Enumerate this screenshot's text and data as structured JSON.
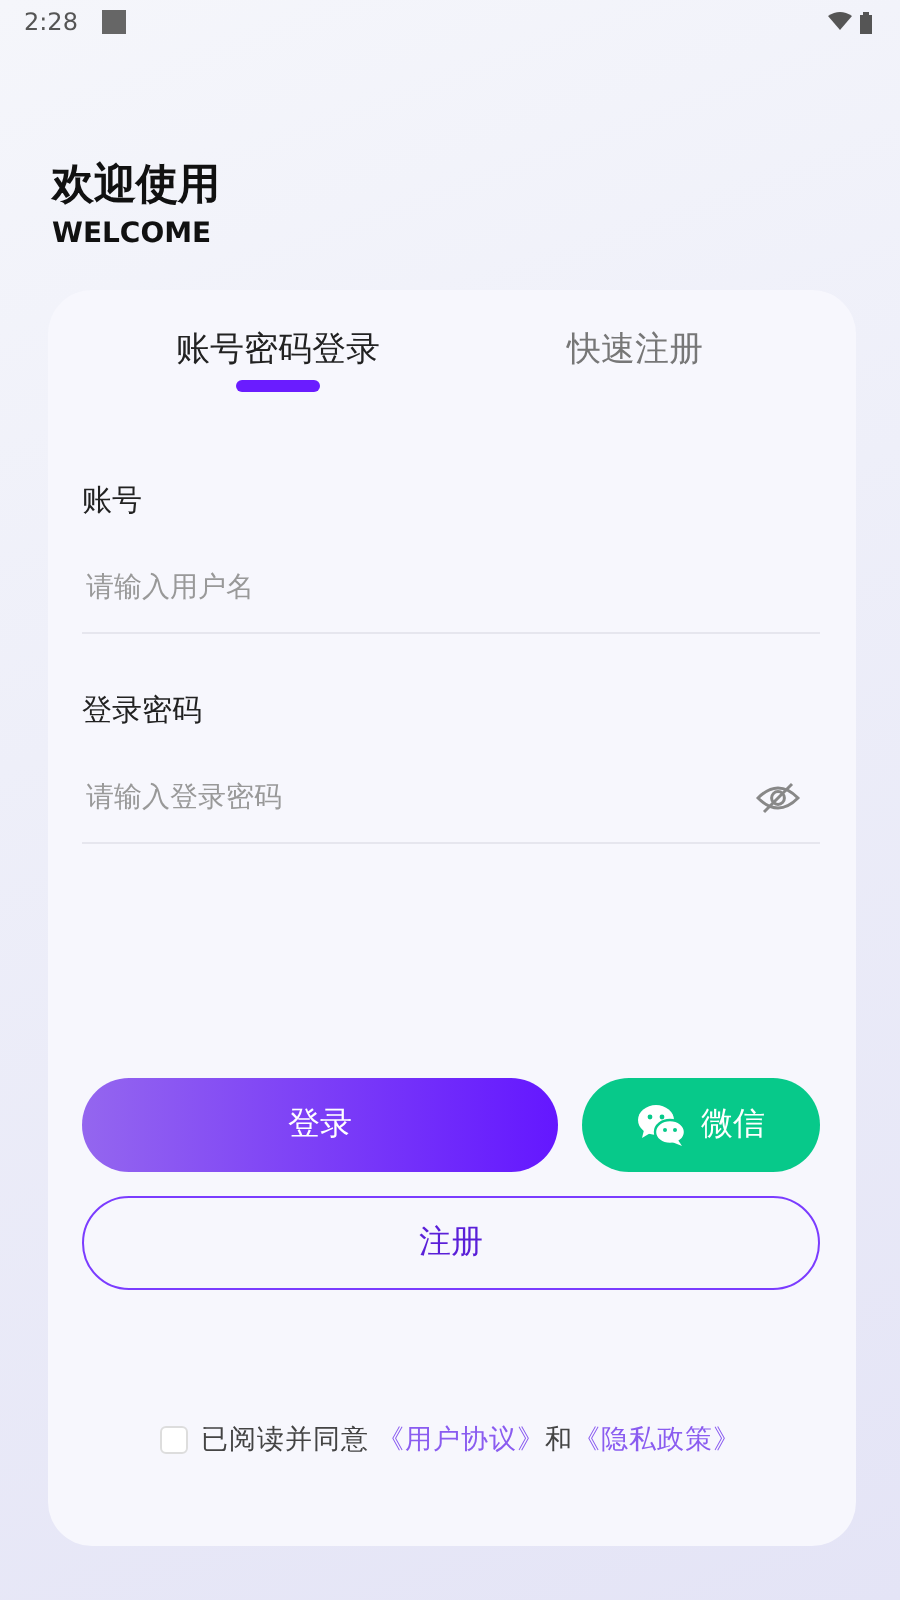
{
  "status_bar": {
    "time": "2:28"
  },
  "header": {
    "title": "欢迎使用",
    "subtitle": "WELCOME"
  },
  "tabs": [
    {
      "label": "账号密码登录",
      "selected": true
    },
    {
      "label": "快速注册",
      "selected": false
    }
  ],
  "fields": [
    {
      "label": "账号",
      "placeholder": "请输入用户名",
      "kind": "text"
    },
    {
      "label": "登录密码",
      "placeholder": "请输入登录密码",
      "kind": "password"
    }
  ],
  "buttons": [
    {
      "label": "登录",
      "kind": "primary"
    },
    {
      "label": "微信",
      "kind": "wechat"
    },
    {
      "label": "注册",
      "kind": "outline"
    }
  ],
  "agreement": {
    "checked": false,
    "text": "已阅读并同意",
    "links": [
      "《用户协议》",
      "《隐私政策》"
    ],
    "joiner": "和"
  }
}
